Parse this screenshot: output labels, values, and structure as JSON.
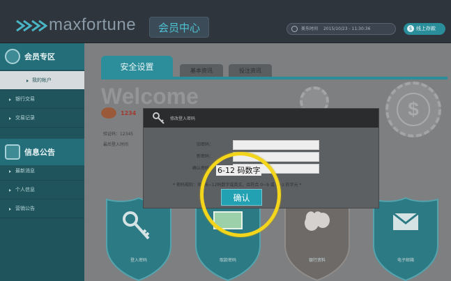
{
  "header": {
    "brand": "maxfortune",
    "member_center": "会员中心",
    "time_label": "美东时间",
    "time_value": "2015/10/23 - 11:30:36",
    "deposit": "线上存款"
  },
  "sidebar": {
    "sections": [
      {
        "title": "会员专区",
        "icon": "user-icon",
        "items": [
          {
            "label": "我的帐户",
            "active": true
          },
          {
            "label": "银行交易"
          },
          {
            "label": "交易记录"
          }
        ]
      },
      {
        "title": "信息公告",
        "icon": "chat-icon",
        "items": [
          {
            "label": "最新消息"
          },
          {
            "label": "个人信息"
          },
          {
            "label": "营销公告"
          }
        ]
      }
    ]
  },
  "main": {
    "tabs": [
      "安全设置",
      "基本资讯",
      "投注资讯"
    ],
    "welcome": "Welcome",
    "balance_prefix": "1234",
    "info_lines": [
      "验证码：12345",
      "最后登入时间"
    ],
    "shields": [
      {
        "label": "登入密码",
        "icon": "key-icon"
      },
      {
        "label": "取款密码",
        "icon": "money-icon"
      },
      {
        "label": "银行资料",
        "icon": "money-bag-icon"
      },
      {
        "label": "电子邮箱",
        "icon": "mail-icon"
      }
    ]
  },
  "modal": {
    "title": "修改登入密码",
    "fields": [
      "旧密码：",
      "新密码：",
      "确认密码："
    ],
    "note": "* 密码规则：须为6~12码数字或英文，且符合 0~9 或 a~z 的字元 *",
    "hint": "6-12 码数字",
    "confirm": "确认"
  }
}
